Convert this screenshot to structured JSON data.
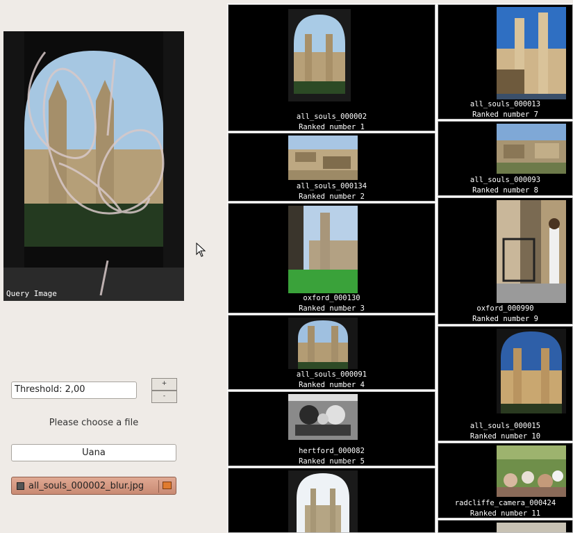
{
  "query": {
    "caption": "Query Image"
  },
  "controls": {
    "threshold_text": "Threshold: 2,00",
    "plus": "+",
    "minus": "-",
    "please_choose": "Please choose a file",
    "name_value": "Uana",
    "file_name": "all_souls_000002_blur.jpg"
  },
  "results": [
    {
      "name": "all_souls_000002",
      "rank": "Ranked number 1"
    },
    {
      "name": "all_souls_000134",
      "rank": "Ranked number 2"
    },
    {
      "name": "oxford_000130",
      "rank": "Ranked number 3"
    },
    {
      "name": "all_souls_000091",
      "rank": "Ranked number 4"
    },
    {
      "name": "hertford_000082",
      "rank": "Ranked number 5"
    },
    {
      "name": "all_souls_000013",
      "rank": "Ranked number 7"
    },
    {
      "name": "all_souls_000093",
      "rank": "Ranked number 8"
    },
    {
      "name": "oxford_000990",
      "rank": "Ranked number 9"
    },
    {
      "name": "all_souls_000015",
      "rank": "Ranked number 10"
    },
    {
      "name": "radcliffe_camera_000424",
      "rank": "Ranked number 11"
    }
  ],
  "icons": {
    "cursor": "mouse-pointer-icon",
    "file": "file-icon",
    "folder": "folder-icon"
  }
}
